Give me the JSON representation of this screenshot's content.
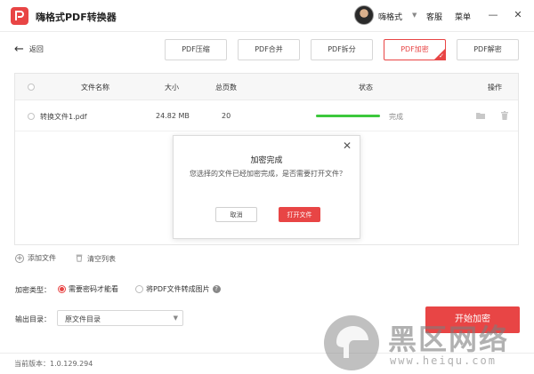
{
  "app": {
    "title": "嗨格式PDF转换器",
    "accent_color": "#e84545",
    "logo_icon": "pdf-logo-icon"
  },
  "header": {
    "user_name": "嗨格式",
    "links": [
      "客服",
      "菜单"
    ],
    "window_controls": [
      "—",
      "✕"
    ]
  },
  "nav": {
    "back_label": "返回"
  },
  "tools": {
    "tabs": [
      "PDF压缩",
      "PDF合并",
      "PDF拆分",
      "PDF加密",
      "PDF解密"
    ],
    "active": "PDF加密"
  },
  "table": {
    "columns": [
      "文件名称",
      "大小",
      "总页数",
      "状态",
      "操作"
    ],
    "rows": [
      {
        "name": "转换文件1.pdf",
        "size": "24.82 MB",
        "pages": "20",
        "status": "完成",
        "progress": 1.0
      }
    ]
  },
  "dialog": {
    "title": "加密完成",
    "message": "您选择的文件已经加密完成，是否需要打开文件？",
    "cancel_label": "取消",
    "open_label": "打开文件",
    "close_glyph": "✕"
  },
  "actions": {
    "add_file": "添加文件",
    "clear_list": "清空列表"
  },
  "encrypt": {
    "label": "加密类型：",
    "options": [
      "需要密码才能看",
      "将PDF文件转成图片"
    ],
    "selected": "需要密码才能看"
  },
  "output": {
    "label": "输出目录：",
    "value": "原文件目录"
  },
  "start_button": "开始加密",
  "footer": {
    "version": "当前版本：1.0.129.294"
  },
  "watermark": {
    "text": "黑区网络",
    "url": "www.heiqu.com"
  }
}
